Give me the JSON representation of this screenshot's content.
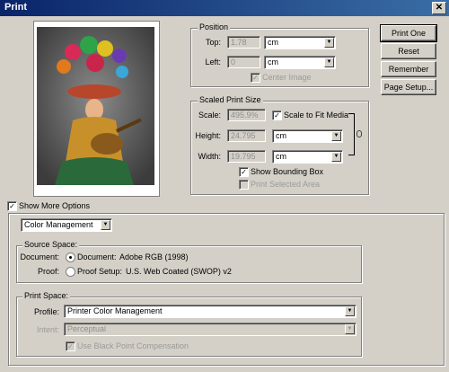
{
  "window": {
    "title": "Print",
    "close_glyph": "✕"
  },
  "buttons": {
    "print_one": "Print One",
    "reset": "Reset",
    "remember": "Remember",
    "page_setup": "Page Setup..."
  },
  "position": {
    "group_label": "Position",
    "top_label": "Top:",
    "top_value": "1.78",
    "top_unit": "cm",
    "left_label": "Left:",
    "left_value": "0",
    "left_unit": "cm",
    "center_image_label": "Center Image",
    "center_image_checked": true
  },
  "scaled": {
    "group_label": "Scaled Print Size",
    "scale_label": "Scale:",
    "scale_value": "495.9%",
    "scale_to_fit_label": "Scale to Fit Media",
    "scale_to_fit_checked": true,
    "height_label": "Height:",
    "height_value": "24.795",
    "height_unit": "cm",
    "width_label": "Width:",
    "width_value": "19.795",
    "width_unit": "cm",
    "bounding_box_label": "Show Bounding Box",
    "bounding_box_checked": true,
    "print_selected_label": "Print Selected Area",
    "print_selected_checked": false
  },
  "more_options": {
    "label": "Show More Options",
    "checked": true
  },
  "mode_select": "Color Management",
  "source": {
    "group_label": "Source Space:",
    "document_row_label": "Document:",
    "document_option_label": "Document:",
    "document_value": "Adobe RGB (1998)",
    "proof_row_label": "Proof:",
    "proof_option_label": "Proof Setup:",
    "proof_value": "U.S. Web Coated (SWOP) v2",
    "selected": "document"
  },
  "print_space": {
    "group_label": "Print Space:",
    "profile_label": "Profile:",
    "profile_value": "Printer Color Management",
    "intent_label": "Intent:",
    "intent_value": "Perceptual",
    "bpc_label": "Use Black Point Compensation",
    "bpc_checked": true
  },
  "icons": {
    "dropdown": "chevron-down-icon",
    "check": "✓"
  }
}
